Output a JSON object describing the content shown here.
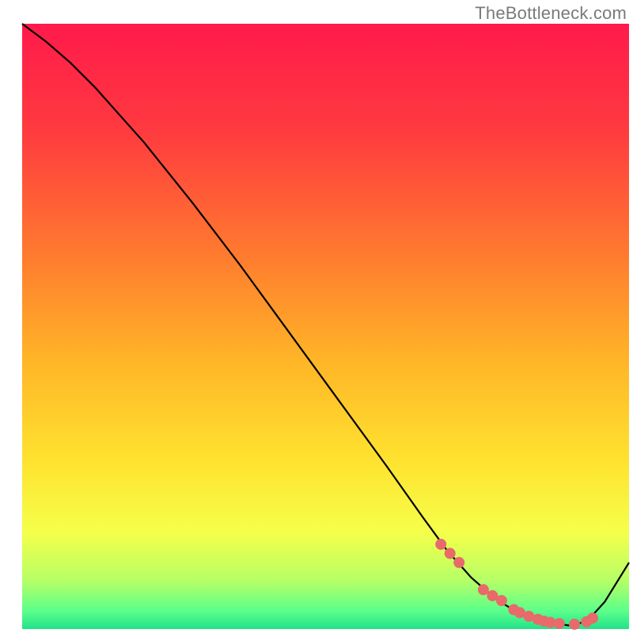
{
  "attribution": "TheBottleneck.com",
  "chart_data": {
    "type": "line",
    "title": "",
    "xlabel": "",
    "ylabel": "",
    "xlim": [
      0,
      100
    ],
    "ylim": [
      0,
      100
    ],
    "background_gradient": {
      "stops": [
        {
          "offset": 0.0,
          "color": "#ff1a4b"
        },
        {
          "offset": 0.18,
          "color": "#ff3b3f"
        },
        {
          "offset": 0.38,
          "color": "#ff7a2f"
        },
        {
          "offset": 0.55,
          "color": "#ffb327"
        },
        {
          "offset": 0.72,
          "color": "#ffe22f"
        },
        {
          "offset": 0.84,
          "color": "#f5ff4a"
        },
        {
          "offset": 0.92,
          "color": "#b6ff66"
        },
        {
          "offset": 0.97,
          "color": "#5cff8a"
        },
        {
          "offset": 1.0,
          "color": "#21e28a"
        }
      ]
    },
    "series": [
      {
        "name": "curve",
        "x": [
          0,
          4,
          8,
          12,
          16,
          20,
          28,
          36,
          44,
          52,
          60,
          66,
          70,
          74,
          78,
          82,
          86,
          90,
          93,
          96,
          100
        ],
        "y": [
          100,
          97,
          93.5,
          89.5,
          85,
          80.5,
          70.5,
          60,
          49,
          38,
          27,
          18.5,
          13,
          8.5,
          5,
          2.5,
          1.2,
          0.6,
          1.2,
          4.5,
          11
        ]
      }
    ],
    "markers": {
      "name": "highlight-dots",
      "color": "#e86a6a",
      "radius_px": 7,
      "x": [
        69,
        70.5,
        72,
        76,
        77.5,
        79,
        81,
        82,
        83.5,
        85,
        86,
        87,
        88.5,
        91,
        93,
        94
      ],
      "y": [
        14,
        12.5,
        11,
        6.5,
        5.5,
        4.7,
        3.2,
        2.7,
        2.1,
        1.6,
        1.3,
        1.1,
        0.9,
        0.8,
        1.2,
        1.8
      ]
    }
  }
}
